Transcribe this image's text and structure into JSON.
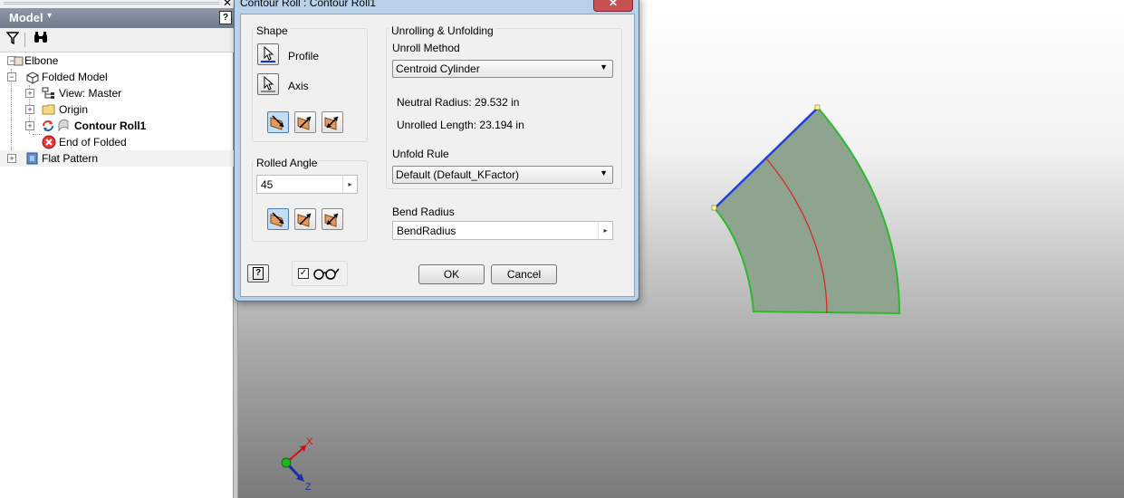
{
  "browser": {
    "title": "Model",
    "caret": "▾",
    "help": "?",
    "close": "✕",
    "tree": [
      {
        "label": "Elbone"
      },
      {
        "label": "Folded Model"
      },
      {
        "label": "View: Master"
      },
      {
        "label": "Origin"
      },
      {
        "label": "Contour Roll1"
      },
      {
        "label": "End of Folded"
      },
      {
        "label": "Flat Pattern"
      }
    ],
    "expand_glyph": "+",
    "collapse_glyph": "−"
  },
  "dialog": {
    "title": "Contour Roll : Contour Roll1",
    "close": "✕",
    "shape": {
      "label": "Shape",
      "profile_label": "Profile",
      "axis_label": "Axis"
    },
    "rolled_angle": {
      "label": "Rolled Angle",
      "value": "45",
      "arrow": "▸"
    },
    "unrolling": {
      "label": "Unrolling & Unfolding",
      "unroll_method_label": "Unroll Method",
      "unroll_method_value": "Centroid Cylinder",
      "neutral_radius": "Neutral Radius: 29.532 in",
      "unrolled_length": "Unrolled Length: 23.194 in",
      "unfold_rule_label": "Unfold Rule",
      "unfold_rule_value": "Default (Default_KFactor)",
      "dropdown_arrow": "▼"
    },
    "bend_radius": {
      "label": "Bend Radius",
      "value": "BendRadius",
      "arrow": "▸"
    },
    "help": "?",
    "preview_checked": "✓",
    "ok_label": "OK",
    "cancel_label": "Cancel"
  },
  "viewport": {
    "axis_x": "X",
    "axis_z": "Z",
    "colors": {
      "face": "#8fa48e",
      "edge": "#2db82d",
      "centerline": "#dd2020",
      "profile": "#2040e0"
    }
  }
}
